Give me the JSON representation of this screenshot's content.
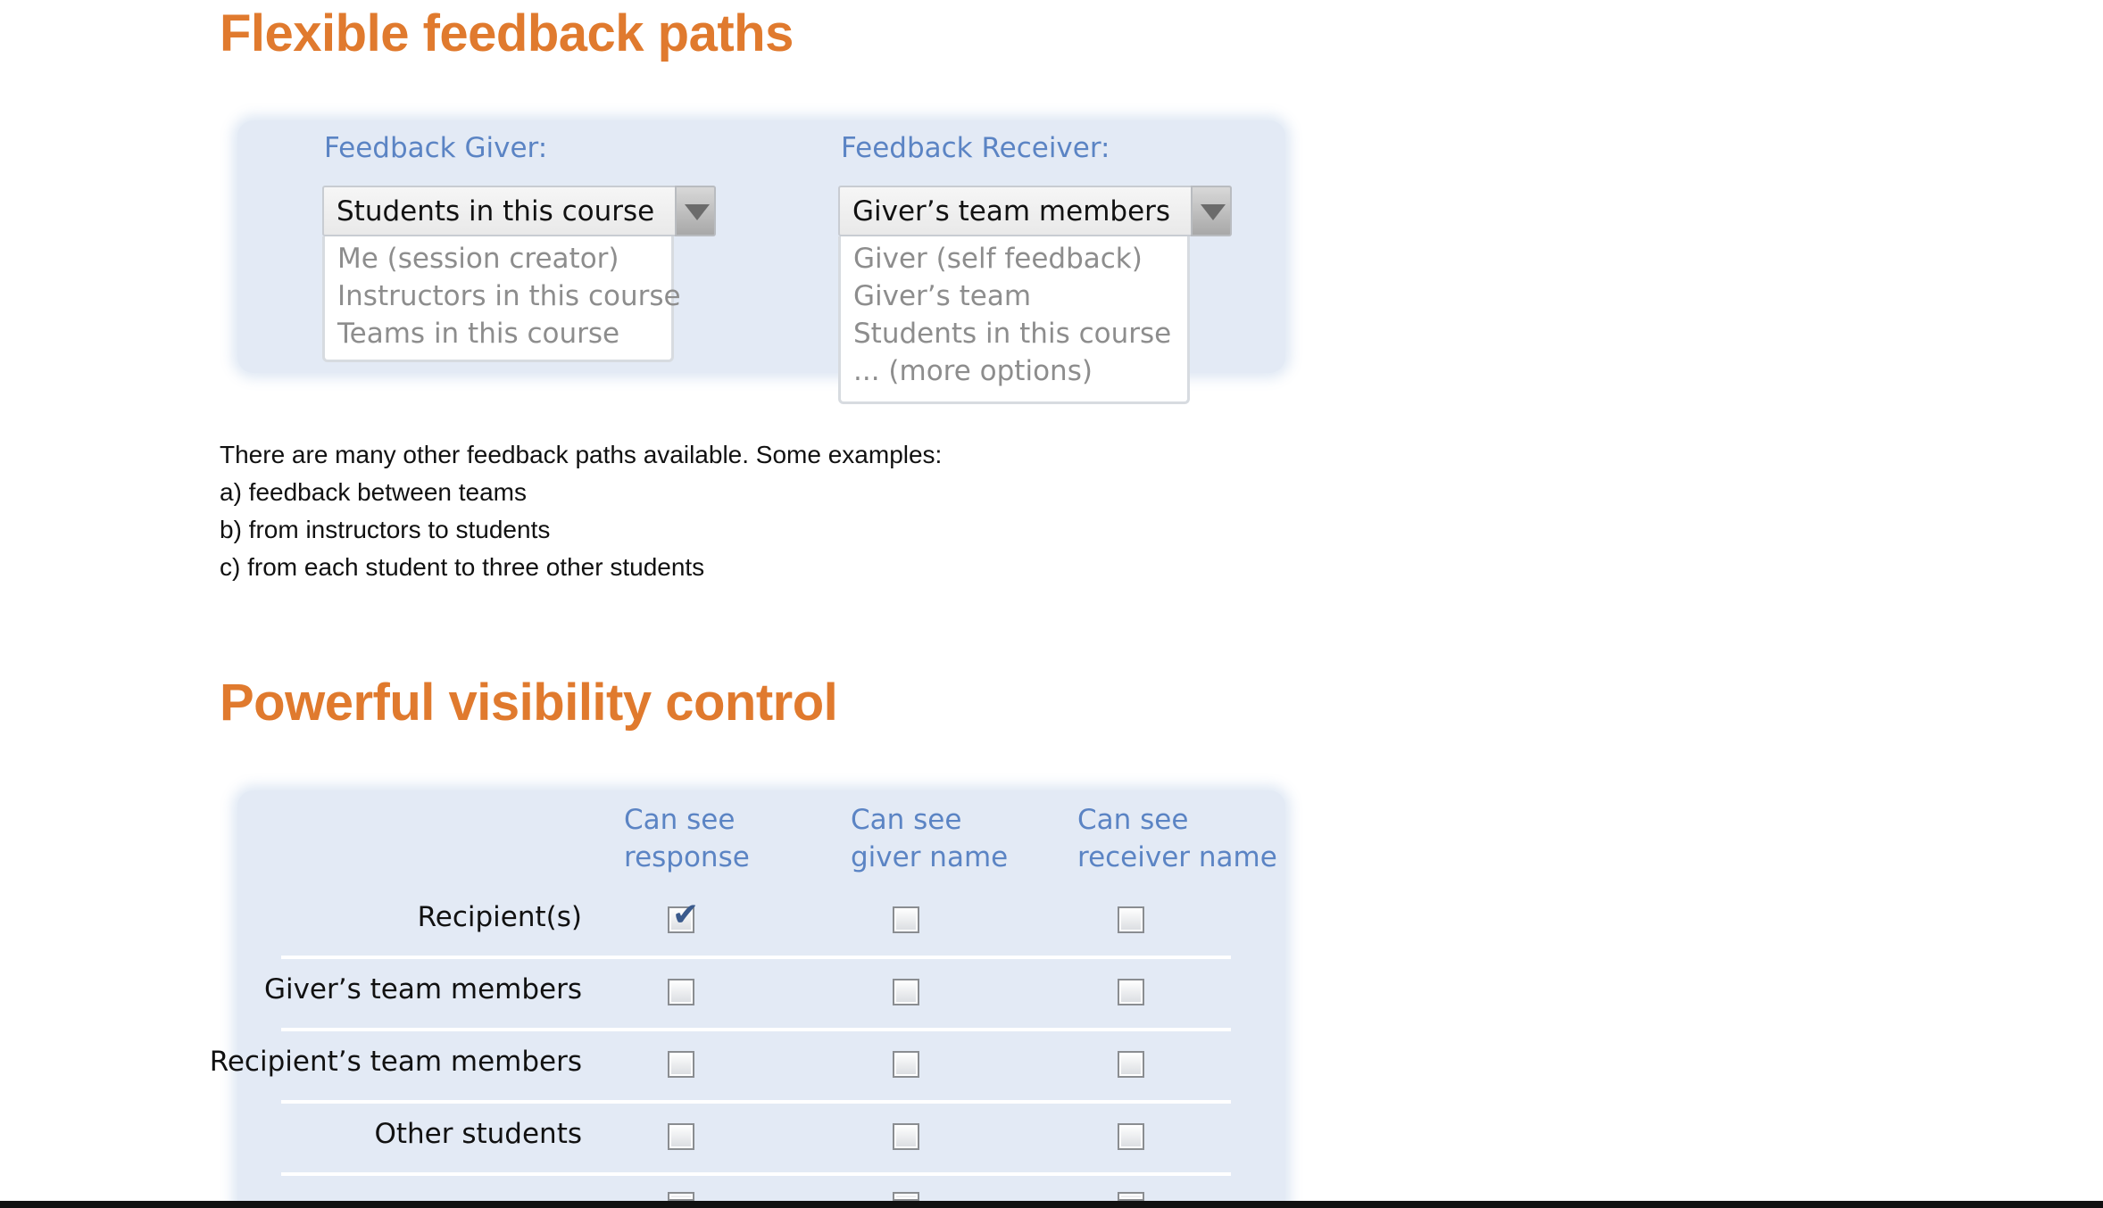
{
  "sections": {
    "feedback_paths": {
      "title": "Flexible feedback paths",
      "giver": {
        "label": "Feedback Giver:",
        "selected": "Students in this course",
        "options": [
          "Me (session creator)",
          "Instructors in this course",
          "Teams in this course"
        ]
      },
      "receiver": {
        "label": "Feedback Receiver:",
        "selected": "Giver’s team members",
        "options": [
          "Giver (self feedback)",
          "Giver’s team",
          "Students in this course",
          "... (more options)"
        ]
      },
      "paragraph": {
        "intro": "There are many other feedback paths available. Some examples:",
        "a": "a) feedback between teams",
        "b": "b) from instructors to students",
        "c": "c) from each student to three other students"
      }
    },
    "visibility": {
      "title": "Powerful visibility control",
      "columns": [
        {
          "line1": "Can see",
          "line2": "response"
        },
        {
          "line1": "Can see",
          "line2": "giver name"
        },
        {
          "line1": "Can see",
          "line2": "receiver name"
        }
      ],
      "rows": [
        {
          "label": "Recipient(s)",
          "checks": [
            true,
            false,
            false
          ]
        },
        {
          "label": "Giver’s team members",
          "checks": [
            false,
            false,
            false
          ]
        },
        {
          "label": "Recipient’s team members",
          "checks": [
            false,
            false,
            false
          ]
        },
        {
          "label": "Other students",
          "checks": [
            false,
            false,
            false
          ]
        }
      ]
    }
  },
  "icons": {
    "dropdown": "chevron-down-icon",
    "checkbox_checked": "check-icon"
  },
  "colors": {
    "heading": "#e07a2e",
    "label_blue": "#5b84c4",
    "panel_bg": "#e3eaf5"
  }
}
